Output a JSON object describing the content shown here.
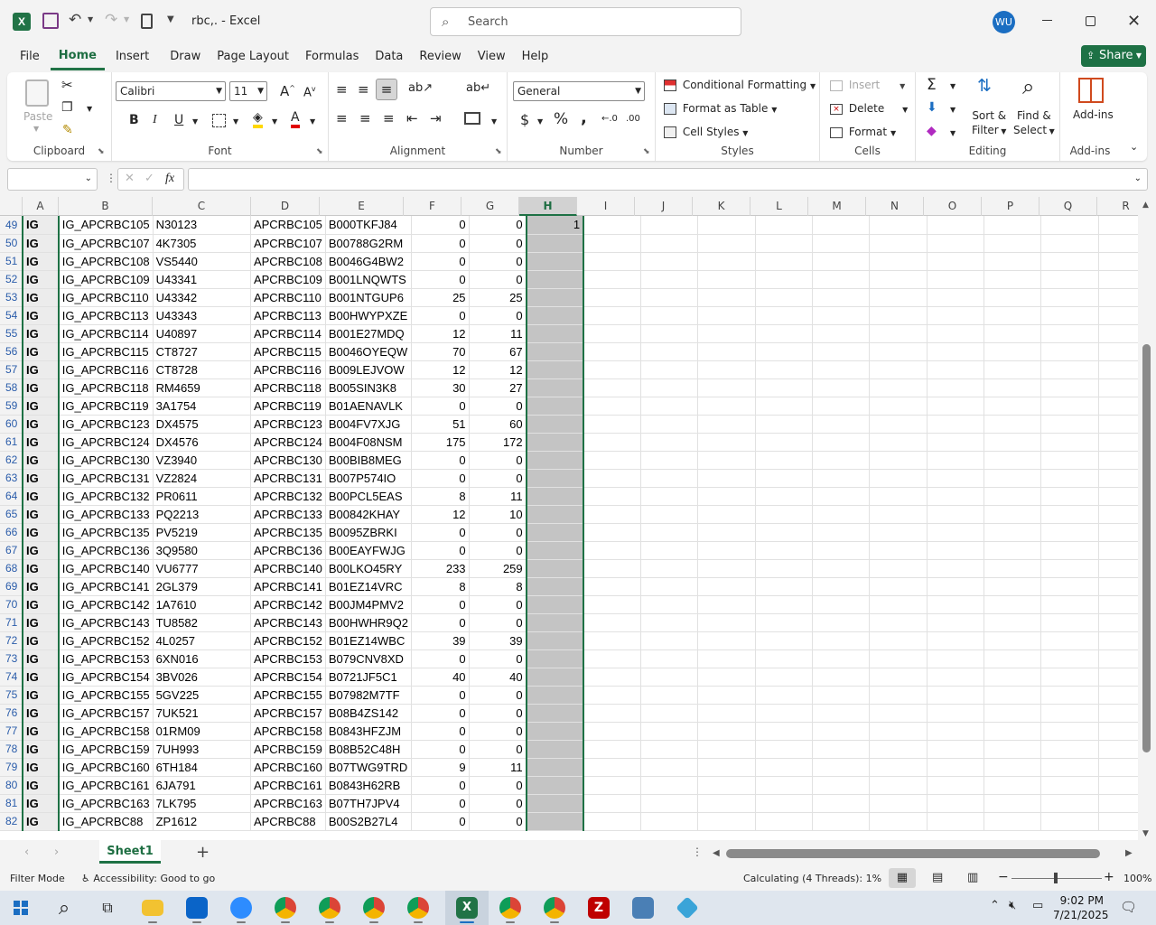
{
  "titlebar": {
    "filename": "rbc,. - Excel",
    "search_placeholder": "Search",
    "user_initials": "WU"
  },
  "menu": {
    "items": [
      "File",
      "Home",
      "Insert",
      "Draw",
      "Page Layout",
      "Formulas",
      "Data",
      "Review",
      "View",
      "Help"
    ],
    "active": "Home",
    "share_label": "Share"
  },
  "ribbon": {
    "clipboard": {
      "label": "Clipboard",
      "paste": "Paste"
    },
    "font": {
      "label": "Font",
      "name": "Calibri",
      "size": "11"
    },
    "alignment": {
      "label": "Alignment"
    },
    "number": {
      "label": "Number",
      "format": "General"
    },
    "styles": {
      "label": "Styles",
      "conditional": "Conditional Formatting",
      "format_table": "Format as Table",
      "cell_styles": "Cell Styles"
    },
    "cells": {
      "label": "Cells",
      "insert": "Insert",
      "delete": "Delete",
      "format": "Format"
    },
    "editing": {
      "label": "Editing",
      "sort": "Sort &",
      "filter": "Filter",
      "find": "Find &",
      "select": "Select"
    },
    "addins": {
      "label": "Add-ins",
      "button": "Add-ins"
    }
  },
  "formula_bar": {
    "name_box": "",
    "fx": "fx",
    "value": ""
  },
  "columns": [
    "A",
    "B",
    "C",
    "D",
    "E",
    "F",
    "G",
    "H",
    "I",
    "J",
    "K",
    "L",
    "M",
    "N",
    "O",
    "P",
    "Q",
    "R"
  ],
  "rows": [
    {
      "n": "49",
      "a": "IG",
      "b": "IG_APCRBC105",
      "c": "N30123",
      "d": "APCRBC105",
      "e": "B000TKFJ84",
      "f": "0",
      "g": "0",
      "h": "1"
    },
    {
      "n": "50",
      "a": "IG",
      "b": "IG_APCRBC107",
      "c": "4K7305",
      "d": "APCRBC107",
      "e": "B00788G2RM",
      "f": "0",
      "g": "0",
      "h": ""
    },
    {
      "n": "51",
      "a": "IG",
      "b": "IG_APCRBC108",
      "c": "VS5440",
      "d": "APCRBC108",
      "e": "B0046G4BW2",
      "f": "0",
      "g": "0",
      "h": ""
    },
    {
      "n": "52",
      "a": "IG",
      "b": "IG_APCRBC109",
      "c": "U43341",
      "d": "APCRBC109",
      "e": "B001LNQWTS",
      "f": "0",
      "g": "0",
      "h": ""
    },
    {
      "n": "53",
      "a": "IG",
      "b": "IG_APCRBC110",
      "c": "U43342",
      "d": "APCRBC110",
      "e": "B001NTGUP6",
      "f": "25",
      "g": "25",
      "h": ""
    },
    {
      "n": "54",
      "a": "IG",
      "b": "IG_APCRBC113",
      "c": "U43343",
      "d": "APCRBC113",
      "e": "B00HWYPXZE",
      "f": "0",
      "g": "0",
      "h": ""
    },
    {
      "n": "55",
      "a": "IG",
      "b": "IG_APCRBC114",
      "c": "U40897",
      "d": "APCRBC114",
      "e": "B001E27MDQ",
      "f": "12",
      "g": "11",
      "h": ""
    },
    {
      "n": "56",
      "a": "IG",
      "b": "IG_APCRBC115",
      "c": "CT8727",
      "d": "APCRBC115",
      "e": "B0046OYEQW",
      "f": "70",
      "g": "67",
      "h": ""
    },
    {
      "n": "57",
      "a": "IG",
      "b": "IG_APCRBC116",
      "c": "CT8728",
      "d": "APCRBC116",
      "e": "B009LEJVOW",
      "f": "12",
      "g": "12",
      "h": ""
    },
    {
      "n": "58",
      "a": "IG",
      "b": "IG_APCRBC118",
      "c": "RM4659",
      "d": "APCRBC118",
      "e": "B005SIN3K8",
      "f": "30",
      "g": "27",
      "h": ""
    },
    {
      "n": "59",
      "a": "IG",
      "b": "IG_APCRBC119",
      "c": "3A1754",
      "d": "APCRBC119",
      "e": "B01AENAVLK",
      "f": "0",
      "g": "0",
      "h": ""
    },
    {
      "n": "60",
      "a": "IG",
      "b": "IG_APCRBC123",
      "c": "DX4575",
      "d": "APCRBC123",
      "e": "B004FV7XJG",
      "f": "51",
      "g": "60",
      "h": ""
    },
    {
      "n": "61",
      "a": "IG",
      "b": "IG_APCRBC124",
      "c": "DX4576",
      "d": "APCRBC124",
      "e": "B004F08NSM",
      "f": "175",
      "g": "172",
      "h": ""
    },
    {
      "n": "62",
      "a": "IG",
      "b": "IG_APCRBC130",
      "c": "VZ3940",
      "d": "APCRBC130",
      "e": "B00BIB8MEG",
      "f": "0",
      "g": "0",
      "h": ""
    },
    {
      "n": "63",
      "a": "IG",
      "b": "IG_APCRBC131",
      "c": "VZ2824",
      "d": "APCRBC131",
      "e": "B007P574IO",
      "f": "0",
      "g": "0",
      "h": ""
    },
    {
      "n": "64",
      "a": "IG",
      "b": "IG_APCRBC132",
      "c": "PR0611",
      "d": "APCRBC132",
      "e": "B00PCL5EAS",
      "f": "8",
      "g": "11",
      "h": ""
    },
    {
      "n": "65",
      "a": "IG",
      "b": "IG_APCRBC133",
      "c": "PQ2213",
      "d": "APCRBC133",
      "e": "B00842KHAY",
      "f": "12",
      "g": "10",
      "h": ""
    },
    {
      "n": "66",
      "a": "IG",
      "b": "IG_APCRBC135",
      "c": "PV5219",
      "d": "APCRBC135",
      "e": "B0095ZBRKI",
      "f": "0",
      "g": "0",
      "h": ""
    },
    {
      "n": "67",
      "a": "IG",
      "b": "IG_APCRBC136",
      "c": "3Q9580",
      "d": "APCRBC136",
      "e": "B00EAYFWJG",
      "f": "0",
      "g": "0",
      "h": ""
    },
    {
      "n": "68",
      "a": "IG",
      "b": "IG_APCRBC140",
      "c": "VU6777",
      "d": "APCRBC140",
      "e": "B00LKO45RY",
      "f": "233",
      "g": "259",
      "h": ""
    },
    {
      "n": "69",
      "a": "IG",
      "b": "IG_APCRBC141",
      "c": "2GL379",
      "d": "APCRBC141",
      "e": "B01EZ14VRC",
      "f": "8",
      "g": "8",
      "h": ""
    },
    {
      "n": "70",
      "a": "IG",
      "b": "IG_APCRBC142",
      "c": "1A7610",
      "d": "APCRBC142",
      "e": "B00JM4PMV2",
      "f": "0",
      "g": "0",
      "h": ""
    },
    {
      "n": "71",
      "a": "IG",
      "b": "IG_APCRBC143",
      "c": "TU8582",
      "d": "APCRBC143",
      "e": "B00HWHR9Q2",
      "f": "0",
      "g": "0",
      "h": ""
    },
    {
      "n": "72",
      "a": "IG",
      "b": "IG_APCRBC152",
      "c": "4L0257",
      "d": "APCRBC152",
      "e": "B01EZ14WBC",
      "f": "39",
      "g": "39",
      "h": ""
    },
    {
      "n": "73",
      "a": "IG",
      "b": "IG_APCRBC153",
      "c": "6XN016",
      "d": "APCRBC153",
      "e": "B079CNV8XD",
      "f": "0",
      "g": "0",
      "h": ""
    },
    {
      "n": "74",
      "a": "IG",
      "b": "IG_APCRBC154",
      "c": "3BV026",
      "d": "APCRBC154",
      "e": "B0721JF5C1",
      "f": "40",
      "g": "40",
      "h": ""
    },
    {
      "n": "75",
      "a": "IG",
      "b": "IG_APCRBC155",
      "c": "5GV225",
      "d": "APCRBC155",
      "e": "B07982M7TF",
      "f": "0",
      "g": "0",
      "h": ""
    },
    {
      "n": "76",
      "a": "IG",
      "b": "IG_APCRBC157",
      "c": "7UK521",
      "d": "APCRBC157",
      "e": "B08B4ZS142",
      "f": "0",
      "g": "0",
      "h": ""
    },
    {
      "n": "77",
      "a": "IG",
      "b": "IG_APCRBC158",
      "c": "01RM09",
      "d": "APCRBC158",
      "e": "B0843HFZJM",
      "f": "0",
      "g": "0",
      "h": ""
    },
    {
      "n": "78",
      "a": "IG",
      "b": "IG_APCRBC159",
      "c": "7UH993",
      "d": "APCRBC159",
      "e": "B08B52C48H",
      "f": "0",
      "g": "0",
      "h": ""
    },
    {
      "n": "79",
      "a": "IG",
      "b": "IG_APCRBC160",
      "c": "6TH184",
      "d": "APCRBC160",
      "e": "B07TWG9TRD",
      "f": "9",
      "g": "11",
      "h": ""
    },
    {
      "n": "80",
      "a": "IG",
      "b": "IG_APCRBC161",
      "c": "6JA791",
      "d": "APCRBC161",
      "e": "B0843H62RB",
      "f": "0",
      "g": "0",
      "h": ""
    },
    {
      "n": "81",
      "a": "IG",
      "b": "IG_APCRBC163",
      "c": "7LK795",
      "d": "APCRBC163",
      "e": "B07TH7JPV4",
      "f": "0",
      "g": "0",
      "h": ""
    },
    {
      "n": "82",
      "a": "IG",
      "b": "IG_APCRBC88",
      "c": "ZP1612",
      "d": "APCRBC88",
      "e": "B00S2B27L4",
      "f": "0",
      "g": "0",
      "h": ""
    }
  ],
  "sheet_tab": "Sheet1",
  "status": {
    "mode": "Filter Mode",
    "accessibility": "Accessibility: Good to go",
    "calc": "Calculating (4 Threads): 1%",
    "zoom": "100%"
  },
  "taskbar": {
    "time": "9:02 PM",
    "date": "7/21/2025"
  },
  "colors": {
    "excel_green": "#217346",
    "accent_blue": "#2a5caa"
  }
}
